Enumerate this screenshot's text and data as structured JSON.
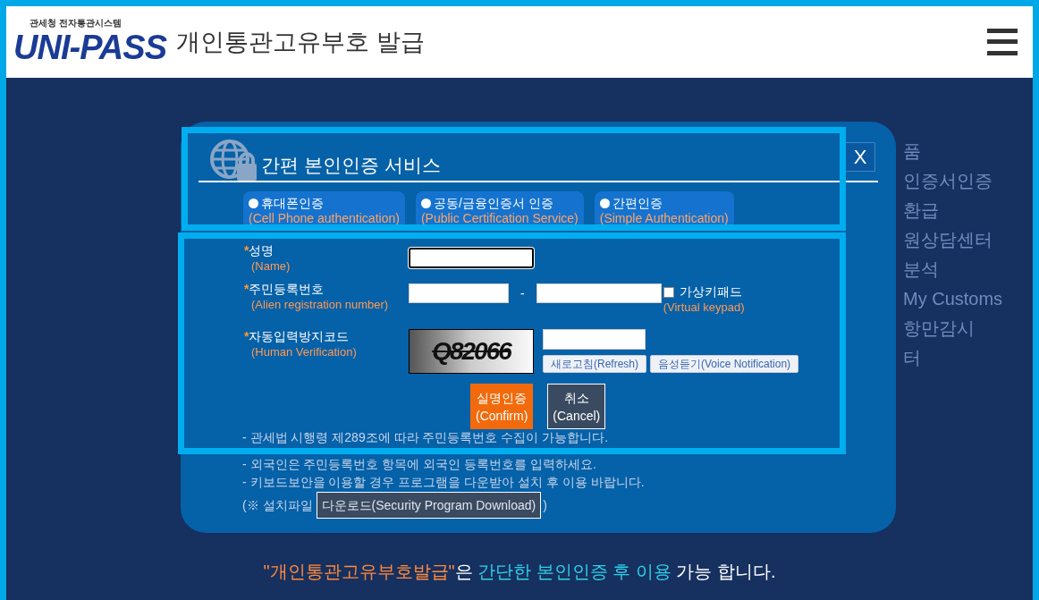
{
  "header": {
    "agency": "관세청 전자통관시스템",
    "logo": "UNI-PASS",
    "title": "개인통관고유부호 발급"
  },
  "background_text": [
    "품",
    "인증서인증",
    "환급",
    "원상담센터",
    "분석",
    "My Customs",
    "항만감시",
    "터"
  ],
  "dialog": {
    "title": "간편 본인인증 서비스",
    "close": "X",
    "methods": [
      {
        "label": "휴대폰인증",
        "sublabel": "(Cell Phone authentication)",
        "selected": false
      },
      {
        "label": "공동/금융인증서 인증",
        "sublabel": "(Public Certification Service)",
        "selected": false
      },
      {
        "label": "간편인증",
        "sublabel": "(Simple Authentication)",
        "selected": false
      }
    ],
    "fields": [
      {
        "kind": "name",
        "required": "*",
        "label": "성명",
        "sublabel": "(Name)",
        "focused": true
      },
      {
        "kind": "split",
        "required": "*",
        "label": "주민등록번호",
        "sublabel": "(Alien registration number)",
        "separator": "-",
        "keypad": {
          "label": "가상키패드",
          "sublabel": "(Virtual keypad)",
          "checked": false
        }
      },
      {
        "kind": "captcha",
        "required": "*",
        "label": "자동입력방지코드",
        "sublabel": "(Human Verification)",
        "code": "Q82066",
        "buttons": [
          "새로고침(Refresh)",
          "음성듣기(Voice Notification)"
        ]
      }
    ],
    "actions": [
      {
        "kind": "primary",
        "label": "실명인증",
        "sublabel": "(Confirm)"
      },
      {
        "kind": "secondary",
        "label": "취소",
        "sublabel": "(Cancel)"
      }
    ],
    "notes": [
      "- 관세법 시행령 제289조에 따라 주민등록번호 수집이 가능합니다.",
      "- 외국인은 주민등록번호 항목에 외국인 등록번호를 입력하세요.",
      "- 키보드보안을 이용할 경우 프로그램을 다운받아 설치 후 이용 바랍니다."
    ],
    "install": {
      "prefix": "(※ 설치파일",
      "button": "다운로드(Security Program Download)",
      "suffix": ")"
    }
  },
  "footer": [
    {
      "kind": "highlight",
      "text": "\"개인통관고유부호발급\""
    },
    {
      "kind": "plain",
      "text": "은 "
    },
    {
      "kind": "accent",
      "text": "간단한 본인인증 후 이용"
    },
    {
      "kind": "plain",
      "text": " 가능 합니다."
    }
  ]
}
